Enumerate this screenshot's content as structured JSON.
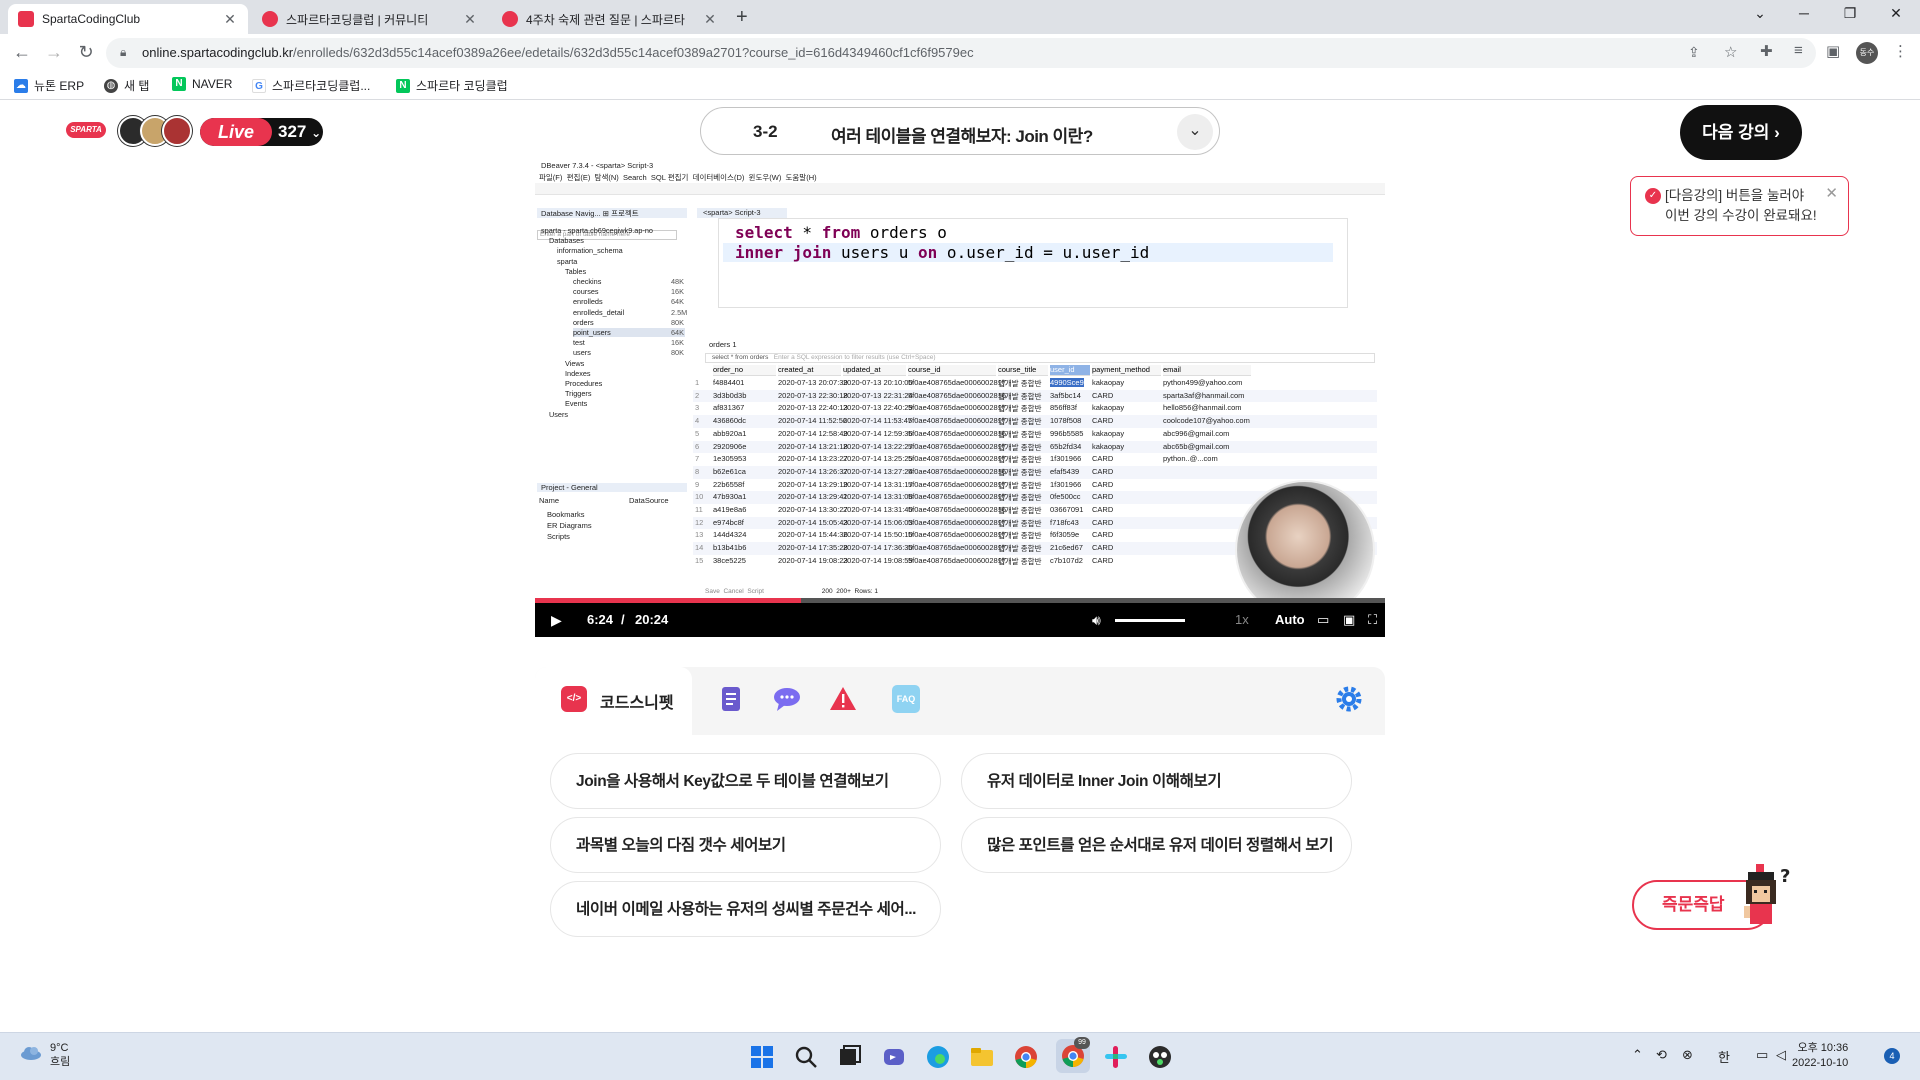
{
  "browser": {
    "tabs": [
      {
        "title": "SpartaCodingClub",
        "active": true
      },
      {
        "title": "스파르타코딩클럽 | 커뮤니티",
        "active": false
      },
      {
        "title": "4주차 숙제 관련 질문 | 스파르타",
        "active": false
      }
    ],
    "url_host": "online.spartacodingclub.kr",
    "url_path": "/enrolleds/632d3d55c14acef0389a26ee/edetails/632d3d55c14acef0389a2701?course_id=616d4349460cf1cf6f9579ec",
    "bookmarks": [
      "뉴톤 ERP",
      "새 탭",
      "NAVER",
      "스파르타코딩클럽...",
      "스파르타 코딩클럽"
    ],
    "profile_label": "동수"
  },
  "header": {
    "logo": "SPARTA",
    "live_label": "Live",
    "live_count": "327",
    "lecture_number": "3-2",
    "lecture_title": "여러 테이블을 연결해보자: Join 이란?",
    "next_button": "다음 강의",
    "toast_line1": "[다음강의] 버튼을 눌러야",
    "toast_line2": "이번 강의 수강이 완료돼요!"
  },
  "video": {
    "app_title": "DBeaver 7.3.4 - <sparta> Script-3",
    "menu": [
      "파일(F)",
      "편집(E)",
      "탐색(N)",
      "Search",
      "SQL 편집기",
      "데이터베이스(D)",
      "윈도우(W)",
      "도움말(H)"
    ],
    "editor_tab": "<sparta> Script-3",
    "sql_line1_kw1": "select",
    "sql_line1_rest": " * ",
    "sql_line1_kw2": "from",
    "sql_line1_tail": " orders o",
    "sql_line2_kw1": "inner join",
    "sql_line2_mid": " users u ",
    "sql_line2_kw2": "on",
    "sql_line2_tail": " o.user_id = u.user_id",
    "nav_tab": "Database Navig...",
    "project_tab": "프로젝트",
    "filter_placeholder": "Enter a part of table name here",
    "results_tab": "orders 1",
    "filter_sql": "select * from orders",
    "filter_hint": "Enter a SQL expression to filter results (use Ctrl+Space)",
    "tree": [
      {
        "label": "sparta - sparta.cb69cegiwk9.ap-no",
        "indent": 0,
        "size": ""
      },
      {
        "label": "Databases",
        "indent": 1,
        "size": ""
      },
      {
        "label": "information_schema",
        "indent": 2,
        "size": ""
      },
      {
        "label": "sparta",
        "indent": 2,
        "size": ""
      },
      {
        "label": "Tables",
        "indent": 3,
        "size": ""
      },
      {
        "label": "checkins",
        "indent": 4,
        "size": "48K"
      },
      {
        "label": "courses",
        "indent": 4,
        "size": "16K"
      },
      {
        "label": "enrolleds",
        "indent": 4,
        "size": "64K"
      },
      {
        "label": "enrolleds_detail",
        "indent": 4,
        "size": "2.5M"
      },
      {
        "label": "orders",
        "indent": 4,
        "size": "80K"
      },
      {
        "label": "point_users",
        "indent": 4,
        "size": "64K"
      },
      {
        "label": "test",
        "indent": 4,
        "size": "16K"
      },
      {
        "label": "users",
        "indent": 4,
        "size": "80K"
      },
      {
        "label": "Views",
        "indent": 3,
        "size": ""
      },
      {
        "label": "Indexes",
        "indent": 3,
        "size": ""
      },
      {
        "label": "Procedures",
        "indent": 3,
        "size": ""
      },
      {
        "label": "Triggers",
        "indent": 3,
        "size": ""
      },
      {
        "label": "Events",
        "indent": 3,
        "size": ""
      },
      {
        "label": "Users",
        "indent": 1,
        "size": ""
      }
    ],
    "project_panel": {
      "title": "Project - General",
      "col1": "Name",
      "col2": "DataSource",
      "items": [
        "Bookmarks",
        "ER Diagrams",
        "Scripts"
      ]
    },
    "columns": [
      "order_no",
      "created_at",
      "updated_at",
      "course_id",
      "course_title",
      "user_id",
      "payment_method",
      "email"
    ],
    "rows": [
      [
        "1",
        "f4884401",
        "2020-07-13 20:07:39",
        "2020-07-13 20:10:00",
        "5f0ae408765dae0006002817",
        "앱개발 종합반",
        "4990Sce9",
        "kakaopay",
        "python499@yahoo.com"
      ],
      [
        "2",
        "3d3b0d3b",
        "2020-07-13 22:30:18",
        "2020-07-13 22:31:24",
        "5f0ae408765dae0006002816",
        "웹개발 종합반",
        "3af5bc14",
        "CARD",
        "sparta3af@hanmail.com"
      ],
      [
        "3",
        "af831367",
        "2020-07-13 22:40:13",
        "2020-07-13 22:40:29",
        "5f0ae408765dae0006002817",
        "앱개발 종합반",
        "856ff83f",
        "kakaopay",
        "hello856@hanmail.com"
      ],
      [
        "4",
        "436860dc",
        "2020-07-14 11:52:56",
        "2020-07-14 11:53:47",
        "5f0ae408765dae0006002817",
        "앱개발 종합반",
        "1078f508",
        "CARD",
        "coolcode107@yahoo.com"
      ],
      [
        "5",
        "abb920a1",
        "2020-07-14 12:58:49",
        "2020-07-14 12:59:36",
        "5f0ae408765dae0006002816",
        "웹개발 종합반",
        "996b5585",
        "kakaopay",
        "abc996@gmail.com"
      ],
      [
        "6",
        "2920906e",
        "2020-07-14 13:21:18",
        "2020-07-14 13:22:27",
        "5f0ae408765dae0006002817",
        "앱개발 종합반",
        "65b2fd34",
        "kakaopay",
        "abc65b@gmail.com"
      ],
      [
        "7",
        "1e305953",
        "2020-07-14 13:23:27",
        "2020-07-14 13:25:25",
        "5f0ae408765dae0006002817",
        "앱개발 종합반",
        "1f301966",
        "CARD",
        "python..@...com"
      ],
      [
        "8",
        "b62e61ca",
        "2020-07-14 13:26:37",
        "2020-07-14 13:27:24",
        "5f0ae408765dae0006002816",
        "웹개발 종합반",
        "efaf5439",
        "CARD",
        ""
      ],
      [
        "9",
        "22b6558f",
        "2020-07-14 13:29:19",
        "2020-07-14 13:31:17",
        "5f0ae408765dae0006002817",
        "앱개발 종합반",
        "1f301966",
        "CARD",
        ""
      ],
      [
        "10",
        "47b930a1",
        "2020-07-14 13:29:41",
        "2020-07-14 13:31:08",
        "5f0ae408765dae0006002817",
        "앱개발 종합반",
        "0fe500cc",
        "CARD",
        ""
      ],
      [
        "11",
        "a419e8a6",
        "2020-07-14 13:30:27",
        "2020-07-14 13:31:40",
        "5f0ae408765dae0006002816",
        "웹개발 종합반",
        "03667091",
        "CARD",
        ""
      ],
      [
        "12",
        "e974bc8f",
        "2020-07-14 15:05:43",
        "2020-07-14 15:06:03",
        "5f0ae408765dae0006002817",
        "앱개발 종합반",
        "f718fc43",
        "CARD",
        ""
      ],
      [
        "13",
        "144d4324",
        "2020-07-14 15:44:36",
        "2020-07-14 15:50:10",
        "5f0ae408765dae0006002817",
        "앱개발 종합반",
        "f6f3059e",
        "CARD",
        ""
      ],
      [
        "14",
        "b13b41b6",
        "2020-07-14 17:35:28",
        "2020-07-14 17:36:30",
        "5f0ae408765dae0006002817",
        "앱개발 종합반",
        "21c6ed67",
        "CARD",
        ""
      ],
      [
        "15",
        "38ce5225",
        "2020-07-14 19:08:23",
        "2020-07-14 19:08:59",
        "5f0ae408765dae0006002817",
        "앱개발 종합반",
        "c7b107d2",
        "CARD",
        ""
      ]
    ],
    "status_fetch": "200",
    "status_more": "200+",
    "status_rows": "Rows: 1",
    "status_save": "Save",
    "status_cancel": "Cancel",
    "status_script": "Script",
    "time_current": "6:24",
    "time_sep": "/",
    "time_total": "20:24",
    "progress_fraction": 0.313,
    "speed": "1x",
    "quality": "Auto"
  },
  "panel": {
    "active_tab": "코드스니펫",
    "icons": [
      "code-snippet-icon",
      "notes-icon",
      "chat-icon",
      "warning-icon",
      "faq-icon",
      "settings-icon"
    ],
    "faq_text": "FAQ",
    "snippets": [
      "Join을 사용해서 Key값으로 두 테이블 연결해보기",
      "유저 데이터로 Inner Join 이해해보기",
      "과목별 오늘의 다짐 갯수 세어보기",
      "많은 포인트를 얻은 순서대로 유저 데이터 정렬해서 보기",
      "네이버 이메일 사용하는 유저의 성씨별 주문건수 세어..."
    ],
    "qa_button": "즉문즉답"
  },
  "taskbar": {
    "temperature": "9°C",
    "weather": "흐림",
    "ime": "한",
    "time": "오후 10:36",
    "date": "2022-10-10",
    "notif_count": "4",
    "chrome_badge": "99"
  },
  "colors": {
    "brand": "#e8344e",
    "dark": "#111111"
  }
}
